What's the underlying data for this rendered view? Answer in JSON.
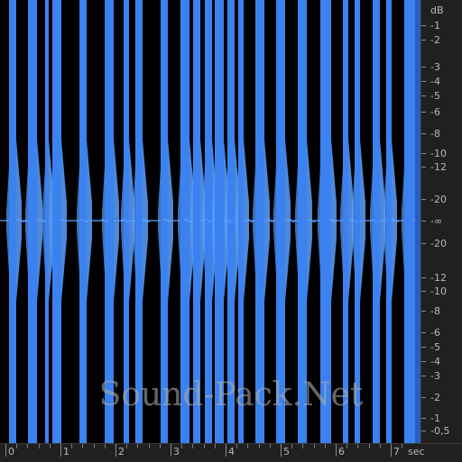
{
  "watermark": "Sound-Pack.Net",
  "db_scale": {
    "unit": "dB",
    "labels": [
      "-1",
      "-2",
      "-3",
      "-4",
      "-5",
      "-6",
      "-8",
      "-10",
      "-12",
      "-20",
      "-∞",
      "-20",
      "-12",
      "-10",
      "-8",
      "-6",
      "-5",
      "-4",
      "-3",
      "-2",
      "-1",
      "-0,5"
    ]
  },
  "time_ruler": {
    "unit": "sec",
    "labels": [
      "0",
      "1",
      "2",
      "3",
      "4",
      "5",
      "6",
      "7"
    ]
  },
  "colors": {
    "waveform": "#3b82f0",
    "waveform_light": "#5aa0ff",
    "background": "#000000",
    "ruler_bg": "#202020",
    "ruler_text": "#b8b8b8"
  },
  "icons": {
    "scale-ticks": "tick-marks"
  }
}
